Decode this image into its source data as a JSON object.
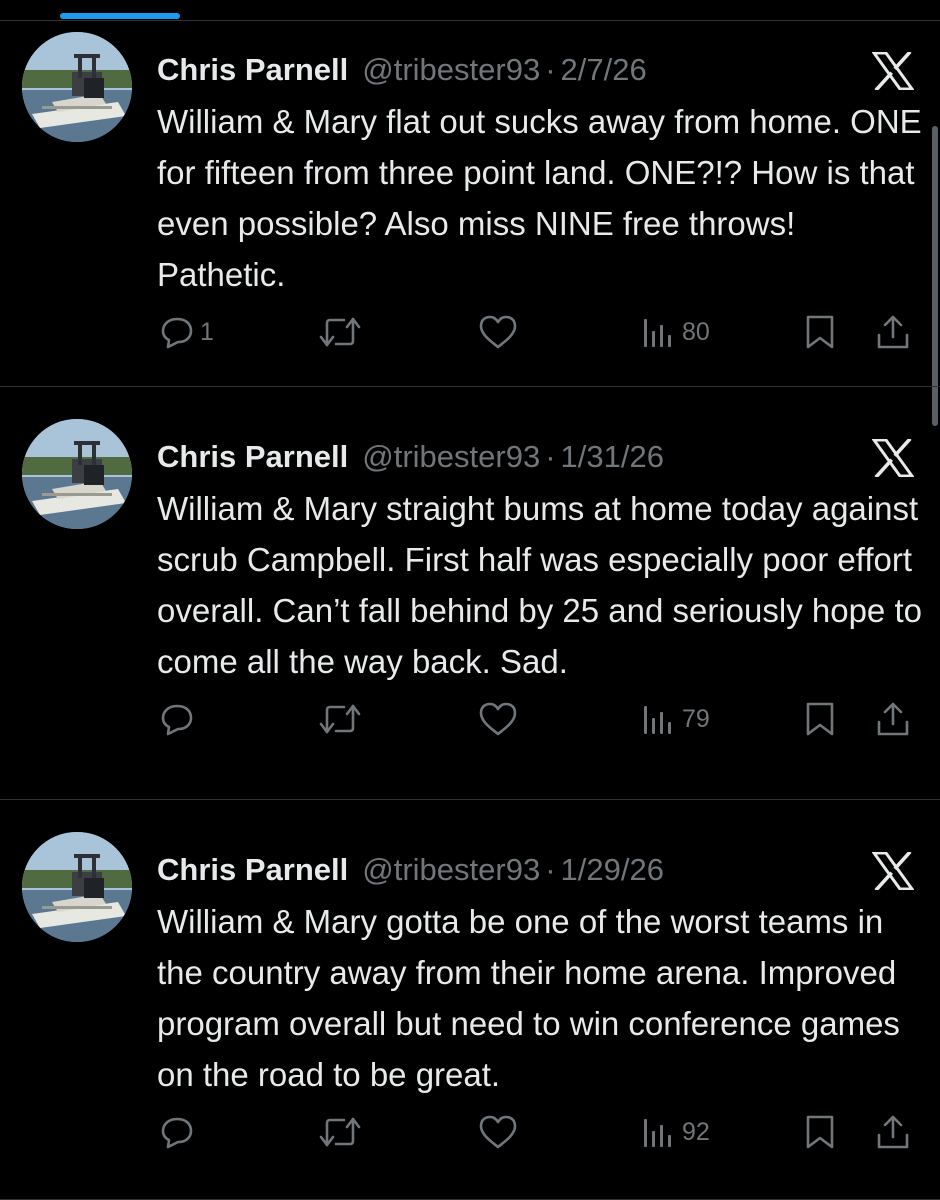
{
  "colors": {
    "background": "#000000",
    "text": "#e7e9ea",
    "secondary_text": "#71767b",
    "divider": "#2f3336",
    "tab_indicator": "#1d9bf0"
  },
  "icons": {
    "platform": "x-logo-icon",
    "reply": "reply-icon",
    "repost": "repost-icon",
    "like": "like-icon",
    "views": "views-icon",
    "bookmark": "bookmark-icon",
    "share": "share-icon"
  },
  "tweets": [
    {
      "author_name": "Chris Parnell",
      "handle": "@tribester93",
      "separator": "·",
      "date": "2/7/26",
      "text": "William & Mary flat out sucks away from home. ONE for fifteen from three point land. ONE?!? How is that even possible? Also miss NINE free throws! Pathetic.",
      "replies": "1",
      "reposts": "",
      "likes": "",
      "views": "80"
    },
    {
      "author_name": "Chris Parnell",
      "handle": "@tribester93",
      "separator": "·",
      "date": "1/31/26",
      "text": "William & Mary straight bums at home today against scrub Campbell. First half was especially poor effort overall. Can’t fall behind by 25 and seriously hope to come all the way back. Sad.",
      "replies": "",
      "reposts": "",
      "likes": "",
      "views": "79"
    },
    {
      "author_name": "Chris Parnell",
      "handle": "@tribester93",
      "separator": "·",
      "date": "1/29/26",
      "text": "William & Mary gotta be one of the worst teams in the country away from their home arena. Improved program overall but need to win conference games on the road to be great.",
      "replies": "",
      "reposts": "",
      "likes": "",
      "views": "92"
    }
  ]
}
